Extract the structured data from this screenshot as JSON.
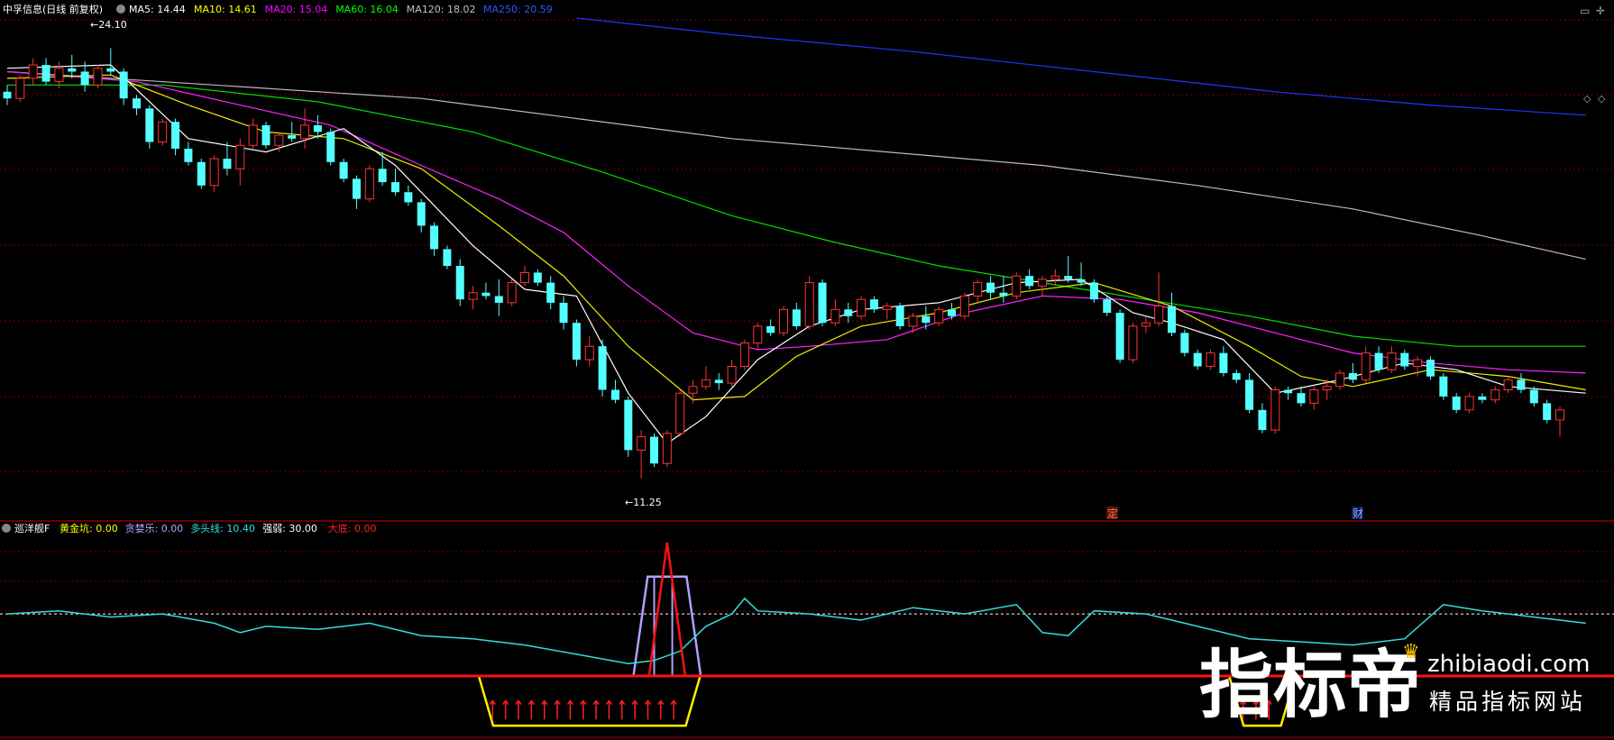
{
  "header": {
    "title": "中孚信息(日线 前复权)",
    "ma": [
      {
        "label": "MA5: 14.44",
        "color": "#ffffff"
      },
      {
        "label": "MA10: 14.61",
        "color": "#ffff00"
      },
      {
        "label": "MA20: 15.04",
        "color": "#ff00ff"
      },
      {
        "label": "MA60: 16.04",
        "color": "#00ff00"
      },
      {
        "label": "MA120: 18.02",
        "color": "#c0c0c0"
      },
      {
        "label": "MA250: 20.59",
        "color": "#3355ff"
      }
    ]
  },
  "indicator": {
    "title": "巡洋舰F",
    "items": [
      {
        "label": "黄金坑: 0.00",
        "color": "#ffff00"
      },
      {
        "label": "贪婪乐: 0.00",
        "color": "#b0a0ff"
      },
      {
        "label": "多头线: 10.40",
        "color": "#33dddd"
      },
      {
        "label": "强弱: 30.00",
        "color": "#ffffff"
      },
      {
        "label": "大底: 0.00",
        "color": "#ff2222"
      }
    ]
  },
  "markers": {
    "high": "24.10",
    "low": "11.25",
    "ding": "定",
    "cai": "财"
  },
  "watermark": {
    "big": "指标帝",
    "domain": "zhibiaodi.com",
    "slogan": "精品指标网站"
  },
  "chart_data": {
    "type": "candlestick",
    "price_high": 24.1,
    "price_low": 11.25,
    "ylim": [
      10.2,
      25.0
    ],
    "up_color": "#ff3333",
    "down_color": "#54ffff",
    "candles": [
      [
        22.8,
        23.0,
        22.4,
        22.6
      ],
      [
        22.6,
        23.3,
        22.5,
        23.2
      ],
      [
        23.2,
        23.8,
        23.0,
        23.6
      ],
      [
        23.6,
        23.8,
        23.0,
        23.1
      ],
      [
        23.1,
        23.7,
        22.9,
        23.5
      ],
      [
        23.5,
        23.9,
        23.2,
        23.4
      ],
      [
        23.4,
        23.7,
        22.8,
        23.0
      ],
      [
        23.0,
        23.6,
        22.9,
        23.5
      ],
      [
        23.5,
        24.1,
        23.3,
        23.4
      ],
      [
        23.4,
        23.5,
        22.4,
        22.6
      ],
      [
        22.6,
        22.7,
        22.1,
        22.3
      ],
      [
        22.3,
        22.4,
        21.1,
        21.3
      ],
      [
        21.3,
        22.0,
        21.2,
        21.9
      ],
      [
        21.9,
        22.0,
        20.9,
        21.1
      ],
      [
        21.1,
        21.3,
        20.6,
        20.7
      ],
      [
        20.7,
        20.8,
        19.9,
        20.0
      ],
      [
        20.0,
        20.9,
        19.8,
        20.8
      ],
      [
        20.8,
        21.3,
        20.3,
        20.5
      ],
      [
        20.5,
        21.4,
        20.0,
        21.2
      ],
      [
        21.2,
        22.0,
        21.1,
        21.8
      ],
      [
        21.8,
        21.9,
        21.1,
        21.2
      ],
      [
        21.2,
        21.6,
        21.0,
        21.5
      ],
      [
        21.5,
        21.9,
        21.3,
        21.4
      ],
      [
        21.4,
        22.3,
        21.1,
        21.8
      ],
      [
        21.8,
        22.1,
        21.4,
        21.6
      ],
      [
        21.6,
        21.7,
        20.6,
        20.7
      ],
      [
        20.7,
        20.8,
        20.1,
        20.2
      ],
      [
        20.2,
        20.3,
        19.3,
        19.6
      ],
      [
        19.6,
        20.6,
        19.5,
        20.5
      ],
      [
        20.5,
        21.0,
        20.0,
        20.1
      ],
      [
        20.1,
        20.5,
        19.7,
        19.8
      ],
      [
        19.8,
        20.0,
        19.4,
        19.5
      ],
      [
        19.5,
        19.6,
        18.6,
        18.8
      ],
      [
        18.8,
        18.9,
        17.9,
        18.1
      ],
      [
        18.1,
        18.2,
        17.5,
        17.6
      ],
      [
        17.6,
        17.8,
        16.4,
        16.6
      ],
      [
        16.6,
        17.0,
        16.3,
        16.8
      ],
      [
        16.8,
        17.1,
        16.6,
        16.7
      ],
      [
        16.7,
        17.2,
        16.1,
        16.5
      ],
      [
        16.5,
        17.2,
        16.4,
        17.1
      ],
      [
        17.1,
        17.6,
        17.0,
        17.4
      ],
      [
        17.4,
        17.5,
        17.0,
        17.1
      ],
      [
        17.1,
        17.3,
        16.3,
        16.5
      ],
      [
        16.5,
        16.7,
        15.7,
        15.9
      ],
      [
        15.9,
        16.0,
        14.6,
        14.8
      ],
      [
        14.8,
        15.5,
        14.6,
        15.2
      ],
      [
        15.2,
        15.4,
        13.7,
        13.9
      ],
      [
        13.9,
        14.2,
        13.5,
        13.6
      ],
      [
        13.6,
        13.7,
        11.9,
        12.1
      ],
      [
        12.1,
        12.7,
        11.25,
        12.5
      ],
      [
        12.5,
        12.6,
        11.6,
        11.7
      ],
      [
        11.7,
        12.7,
        11.6,
        12.6
      ],
      [
        12.6,
        13.9,
        12.5,
        13.8
      ],
      [
        13.8,
        14.2,
        13.5,
        14.0
      ],
      [
        14.0,
        14.6,
        13.9,
        14.2
      ],
      [
        14.2,
        14.4,
        13.9,
        14.1
      ],
      [
        14.1,
        14.8,
        14.0,
        14.6
      ],
      [
        14.6,
        15.4,
        14.5,
        15.3
      ],
      [
        15.3,
        15.9,
        15.1,
        15.8
      ],
      [
        15.8,
        16.0,
        15.5,
        15.6
      ],
      [
        15.6,
        16.4,
        15.5,
        16.3
      ],
      [
        16.3,
        16.5,
        15.7,
        15.8
      ],
      [
        15.8,
        17.3,
        15.7,
        17.1
      ],
      [
        17.1,
        17.2,
        15.8,
        15.9
      ],
      [
        15.9,
        16.6,
        15.8,
        16.3
      ],
      [
        16.3,
        16.5,
        15.9,
        16.1
      ],
      [
        16.1,
        16.7,
        16.0,
        16.6
      ],
      [
        16.6,
        16.7,
        16.2,
        16.3
      ],
      [
        16.3,
        16.5,
        16.0,
        16.4
      ],
      [
        16.4,
        16.5,
        15.7,
        15.8
      ],
      [
        15.8,
        16.2,
        15.6,
        16.1
      ],
      [
        16.1,
        16.4,
        15.7,
        15.9
      ],
      [
        15.9,
        16.4,
        15.8,
        16.3
      ],
      [
        16.3,
        16.5,
        16.0,
        16.1
      ],
      [
        16.1,
        16.8,
        16.0,
        16.7
      ],
      [
        16.7,
        17.2,
        16.5,
        17.1
      ],
      [
        17.1,
        17.3,
        16.6,
        16.8
      ],
      [
        16.8,
        17.3,
        16.5,
        16.7
      ],
      [
        16.7,
        17.4,
        16.6,
        17.3
      ],
      [
        17.3,
        17.5,
        16.9,
        17.0
      ],
      [
        17.0,
        17.3,
        16.7,
        17.2
      ],
      [
        17.2,
        17.5,
        17.0,
        17.3
      ],
      [
        17.3,
        17.9,
        17.1,
        17.2
      ],
      [
        17.2,
        17.7,
        17.0,
        17.1
      ],
      [
        17.1,
        17.2,
        16.5,
        16.6
      ],
      [
        16.6,
        16.7,
        16.1,
        16.2
      ],
      [
        16.2,
        16.3,
        14.7,
        14.8
      ],
      [
        14.8,
        15.9,
        14.7,
        15.8
      ],
      [
        15.8,
        16.1,
        15.6,
        15.9
      ],
      [
        15.9,
        17.4,
        15.8,
        16.4
      ],
      [
        16.4,
        16.8,
        15.5,
        15.6
      ],
      [
        15.6,
        15.7,
        14.9,
        15.0
      ],
      [
        15.0,
        15.1,
        14.5,
        14.6
      ],
      [
        14.6,
        15.1,
        14.5,
        15.0
      ],
      [
        15.0,
        15.2,
        14.3,
        14.4
      ],
      [
        14.4,
        14.5,
        14.1,
        14.2
      ],
      [
        14.2,
        14.4,
        13.2,
        13.3
      ],
      [
        13.3,
        13.5,
        12.6,
        12.7
      ],
      [
        12.7,
        14.0,
        12.6,
        13.9
      ],
      [
        13.9,
        14.0,
        13.6,
        13.8
      ],
      [
        13.8,
        14.0,
        13.4,
        13.5
      ],
      [
        13.5,
        14.0,
        13.3,
        13.9
      ],
      [
        13.9,
        14.2,
        13.6,
        14.0
      ],
      [
        14.0,
        14.5,
        13.9,
        14.4
      ],
      [
        14.4,
        14.7,
        14.1,
        14.2
      ],
      [
        14.2,
        15.2,
        14.1,
        15.0
      ],
      [
        15.0,
        15.2,
        14.4,
        14.5
      ],
      [
        14.5,
        15.2,
        14.4,
        15.0
      ],
      [
        15.0,
        15.1,
        14.5,
        14.6
      ],
      [
        14.6,
        14.9,
        14.3,
        14.8
      ],
      [
        14.8,
        14.9,
        14.2,
        14.3
      ],
      [
        14.3,
        14.4,
        13.6,
        13.7
      ],
      [
        13.7,
        13.8,
        13.2,
        13.3
      ],
      [
        13.3,
        13.8,
        13.2,
        13.7
      ],
      [
        13.7,
        13.8,
        13.5,
        13.6
      ],
      [
        13.6,
        14.0,
        13.5,
        13.9
      ],
      [
        13.9,
        14.3,
        13.8,
        14.2
      ],
      [
        14.2,
        14.4,
        13.8,
        13.9
      ],
      [
        13.9,
        14.0,
        13.4,
        13.5
      ],
      [
        13.5,
        13.6,
        12.9,
        13.0
      ],
      [
        13.0,
        13.4,
        12.5,
        13.3
      ]
    ],
    "ma5": [
      {
        "x": 0,
        "y": 23.5
      },
      {
        "x": 8,
        "y": 23.6
      },
      {
        "x": 14,
        "y": 21.4
      },
      {
        "x": 20,
        "y": 21.0
      },
      {
        "x": 26,
        "y": 21.7
      },
      {
        "x": 30,
        "y": 20.6
      },
      {
        "x": 36,
        "y": 18.2
      },
      {
        "x": 40,
        "y": 16.9
      },
      {
        "x": 44,
        "y": 16.7
      },
      {
        "x": 48,
        "y": 13.8
      },
      {
        "x": 51,
        "y": 12.3
      },
      {
        "x": 54,
        "y": 13.1
      },
      {
        "x": 58,
        "y": 14.8
      },
      {
        "x": 62,
        "y": 15.8
      },
      {
        "x": 66,
        "y": 16.3
      },
      {
        "x": 72,
        "y": 16.5
      },
      {
        "x": 78,
        "y": 17.1
      },
      {
        "x": 83,
        "y": 17.2
      },
      {
        "x": 87,
        "y": 16.2
      },
      {
        "x": 90,
        "y": 15.9
      },
      {
        "x": 94,
        "y": 15.4
      },
      {
        "x": 98,
        "y": 13.8
      },
      {
        "x": 103,
        "y": 14.2
      },
      {
        "x": 108,
        "y": 14.7
      },
      {
        "x": 112,
        "y": 14.5
      },
      {
        "x": 116,
        "y": 14.0
      },
      {
        "x": 122,
        "y": 13.8
      }
    ],
    "ma10": [
      {
        "x": 0,
        "y": 23.2
      },
      {
        "x": 8,
        "y": 23.3
      },
      {
        "x": 14,
        "y": 22.4
      },
      {
        "x": 20,
        "y": 21.6
      },
      {
        "x": 26,
        "y": 21.4
      },
      {
        "x": 32,
        "y": 20.5
      },
      {
        "x": 38,
        "y": 18.8
      },
      {
        "x": 43,
        "y": 17.3
      },
      {
        "x": 48,
        "y": 15.2
      },
      {
        "x": 53,
        "y": 13.6
      },
      {
        "x": 57,
        "y": 13.7
      },
      {
        "x": 61,
        "y": 14.9
      },
      {
        "x": 66,
        "y": 15.8
      },
      {
        "x": 72,
        "y": 16.2
      },
      {
        "x": 78,
        "y": 16.8
      },
      {
        "x": 84,
        "y": 17.1
      },
      {
        "x": 90,
        "y": 16.4
      },
      {
        "x": 96,
        "y": 15.2
      },
      {
        "x": 100,
        "y": 14.3
      },
      {
        "x": 104,
        "y": 14.0
      },
      {
        "x": 110,
        "y": 14.5
      },
      {
        "x": 116,
        "y": 14.3
      },
      {
        "x": 122,
        "y": 13.9
      }
    ],
    "ma20": [
      {
        "x": 0,
        "y": 23.4
      },
      {
        "x": 10,
        "y": 23.1
      },
      {
        "x": 18,
        "y": 22.4
      },
      {
        "x": 25,
        "y": 21.8
      },
      {
        "x": 32,
        "y": 20.6
      },
      {
        "x": 38,
        "y": 19.6
      },
      {
        "x": 43,
        "y": 18.6
      },
      {
        "x": 48,
        "y": 17.0
      },
      {
        "x": 53,
        "y": 15.6
      },
      {
        "x": 58,
        "y": 15.1
      },
      {
        "x": 62,
        "y": 15.2
      },
      {
        "x": 68,
        "y": 15.4
      },
      {
        "x": 74,
        "y": 16.2
      },
      {
        "x": 80,
        "y": 16.7
      },
      {
        "x": 86,
        "y": 16.6
      },
      {
        "x": 92,
        "y": 16.2
      },
      {
        "x": 98,
        "y": 15.6
      },
      {
        "x": 104,
        "y": 15.0
      },
      {
        "x": 110,
        "y": 14.7
      },
      {
        "x": 116,
        "y": 14.5
      },
      {
        "x": 122,
        "y": 14.4
      }
    ],
    "ma60": [
      {
        "x": 0,
        "y": 23.0
      },
      {
        "x": 12,
        "y": 23.0
      },
      {
        "x": 24,
        "y": 22.5
      },
      {
        "x": 36,
        "y": 21.6
      },
      {
        "x": 46,
        "y": 20.4
      },
      {
        "x": 56,
        "y": 19.1
      },
      {
        "x": 64,
        "y": 18.3
      },
      {
        "x": 72,
        "y": 17.6
      },
      {
        "x": 80,
        "y": 17.1
      },
      {
        "x": 88,
        "y": 16.6
      },
      {
        "x": 96,
        "y": 16.1
      },
      {
        "x": 104,
        "y": 15.5
      },
      {
        "x": 112,
        "y": 15.2
      },
      {
        "x": 122,
        "y": 15.2
      }
    ],
    "ma120": [
      {
        "x": 0,
        "y": 23.4
      },
      {
        "x": 16,
        "y": 23.0
      },
      {
        "x": 32,
        "y": 22.6
      },
      {
        "x": 44,
        "y": 22.0
      },
      {
        "x": 56,
        "y": 21.4
      },
      {
        "x": 68,
        "y": 21.0
      },
      {
        "x": 80,
        "y": 20.6
      },
      {
        "x": 92,
        "y": 20.0
      },
      {
        "x": 104,
        "y": 19.3
      },
      {
        "x": 114,
        "y": 18.5
      },
      {
        "x": 122,
        "y": 17.8
      }
    ],
    "ma250": [
      {
        "x": 44,
        "y": 25.0
      },
      {
        "x": 56,
        "y": 24.5
      },
      {
        "x": 70,
        "y": 24.0
      },
      {
        "x": 84,
        "y": 23.4
      },
      {
        "x": 98,
        "y": 22.8
      },
      {
        "x": 110,
        "y": 22.4
      },
      {
        "x": 122,
        "y": 22.1
      }
    ],
    "indicator_panel": {
      "ylim": [
        -8,
        55
      ],
      "dashed_level": 30,
      "zero_level": 10,
      "strength": [
        {
          "x": 0,
          "y": 30
        },
        {
          "x": 4,
          "y": 31
        },
        {
          "x": 8,
          "y": 29
        },
        {
          "x": 12,
          "y": 30
        },
        {
          "x": 16,
          "y": 27
        },
        {
          "x": 18,
          "y": 24
        },
        {
          "x": 20,
          "y": 26
        },
        {
          "x": 24,
          "y": 25
        },
        {
          "x": 28,
          "y": 27
        },
        {
          "x": 32,
          "y": 23
        },
        {
          "x": 36,
          "y": 22
        },
        {
          "x": 40,
          "y": 20
        },
        {
          "x": 44,
          "y": 17
        },
        {
          "x": 48,
          "y": 14
        },
        {
          "x": 50,
          "y": 15
        },
        {
          "x": 52,
          "y": 18
        },
        {
          "x": 54,
          "y": 26
        },
        {
          "x": 56,
          "y": 30
        },
        {
          "x": 57,
          "y": 35
        },
        {
          "x": 58,
          "y": 31
        },
        {
          "x": 62,
          "y": 30
        },
        {
          "x": 66,
          "y": 28
        },
        {
          "x": 70,
          "y": 32
        },
        {
          "x": 74,
          "y": 30
        },
        {
          "x": 78,
          "y": 33
        },
        {
          "x": 80,
          "y": 24
        },
        {
          "x": 82,
          "y": 23
        },
        {
          "x": 84,
          "y": 31
        },
        {
          "x": 88,
          "y": 30
        },
        {
          "x": 92,
          "y": 26
        },
        {
          "x": 96,
          "y": 22
        },
        {
          "x": 100,
          "y": 21
        },
        {
          "x": 104,
          "y": 20
        },
        {
          "x": 108,
          "y": 22
        },
        {
          "x": 111,
          "y": 33
        },
        {
          "x": 114,
          "y": 31
        },
        {
          "x": 118,
          "y": 29
        },
        {
          "x": 122,
          "y": 27
        }
      ],
      "peak_red": [
        {
          "x": 49.6,
          "y": 10
        },
        {
          "x": 51,
          "y": 53
        },
        {
          "x": 52.4,
          "y": 10
        }
      ],
      "greed_lavender": [
        {
          "x": 48.4,
          "y": 10
        },
        {
          "x": 49.5,
          "y": 42
        },
        {
          "x": 52.5,
          "y": 42
        },
        {
          "x": 53.6,
          "y": 10
        }
      ],
      "golden_pit_spans": [
        [
          37,
          53
        ],
        [
          95,
          99
        ]
      ],
      "bottom_arrows": [
        38,
        39,
        40,
        41,
        42,
        43,
        44,
        45,
        46,
        47,
        48,
        49,
        50,
        51,
        52,
        96,
        97,
        98
      ]
    }
  }
}
